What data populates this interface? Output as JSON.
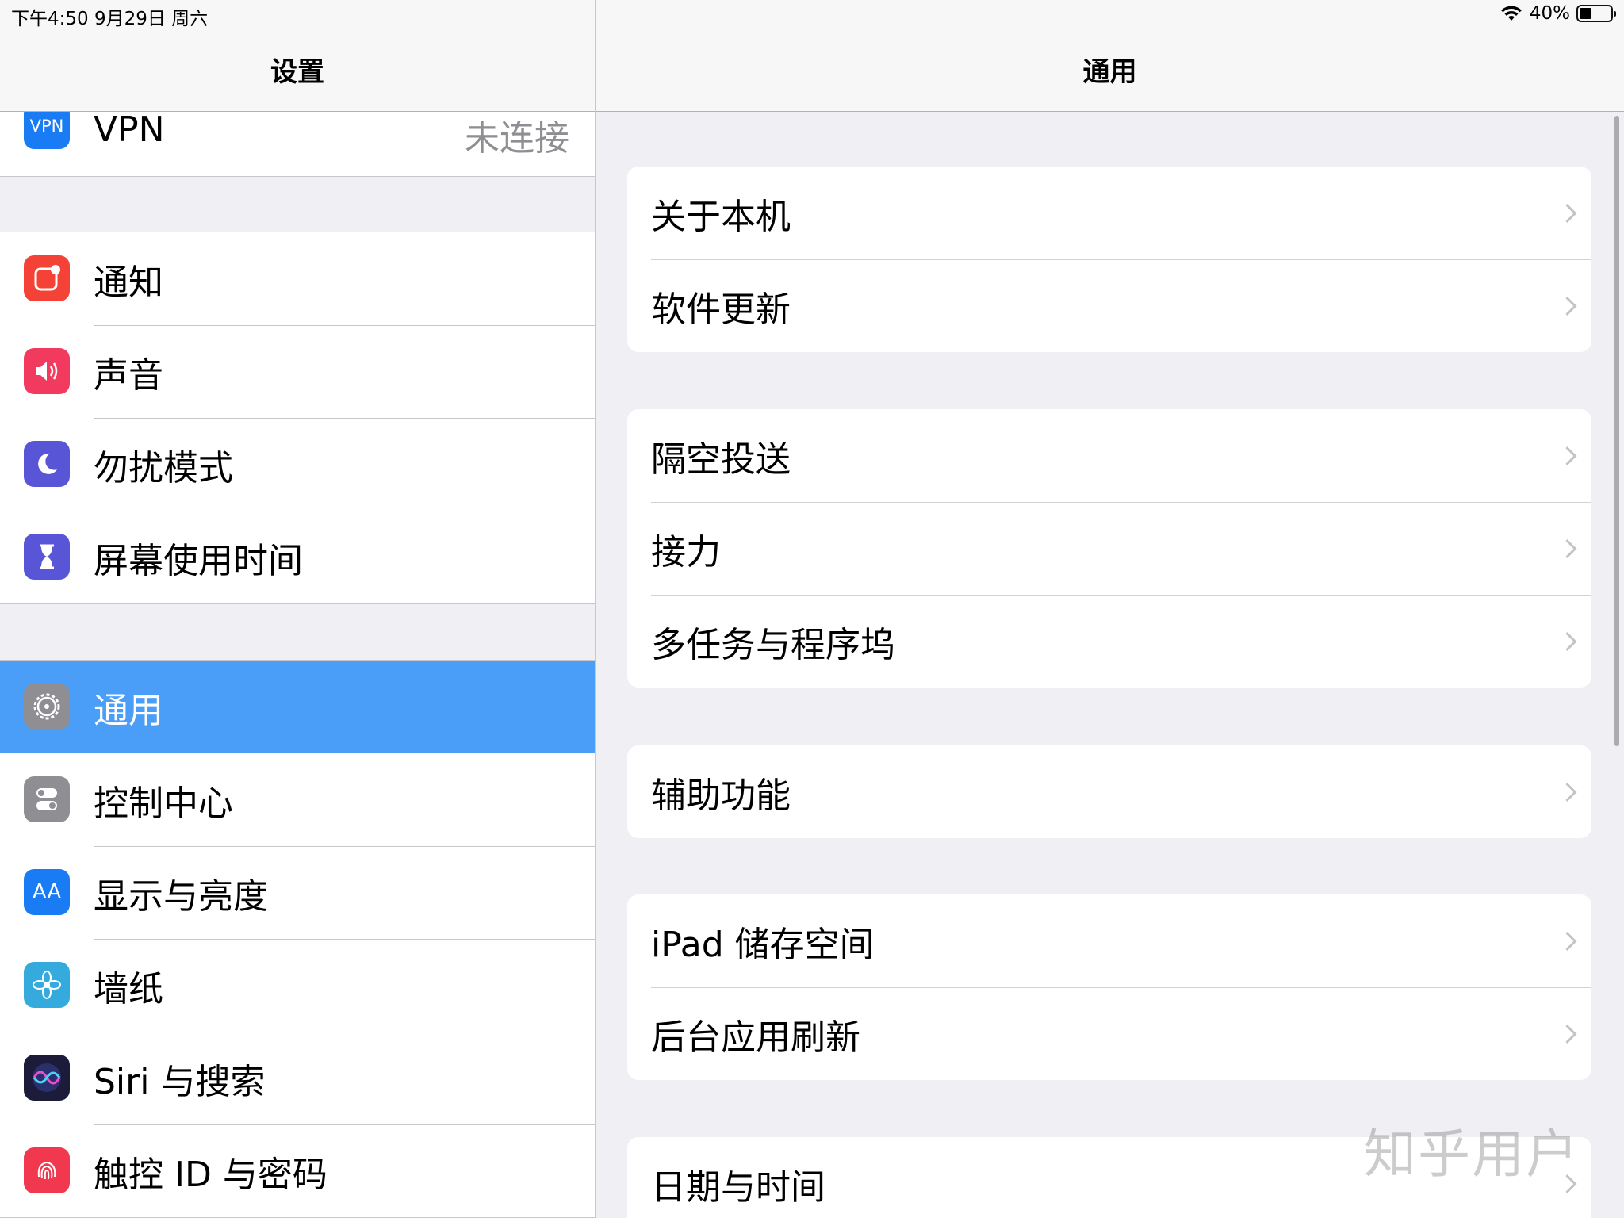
{
  "status_bar": {
    "time_date": "下午4:50  9月29日 周六",
    "battery": "40%",
    "battery_level": 0.4
  },
  "master": {
    "title": "设置",
    "vpn": {
      "icon_text": "VPN",
      "label": "VPN",
      "detail": "未连接"
    },
    "group1": [
      {
        "label": "通知",
        "icon": "notifications-icon",
        "color": "#f44336"
      },
      {
        "label": "声音",
        "icon": "sound-icon",
        "color": "#f23a5f"
      },
      {
        "label": "勿扰模式",
        "icon": "moon-icon",
        "color": "#5856d6"
      },
      {
        "label": "屏幕使用时间",
        "icon": "hourglass-icon",
        "color": "#5856d6"
      }
    ],
    "group2": [
      {
        "label": "通用",
        "icon": "gear-icon",
        "color": "#8e8e93",
        "selected": true
      },
      {
        "label": "控制中心",
        "icon": "toggles-icon",
        "color": "#8e8e93"
      },
      {
        "label": "显示与亮度",
        "icon": "text-size-icon",
        "color": "#1a7cf5",
        "icon_text": "AA"
      },
      {
        "label": "墙纸",
        "icon": "flower-icon",
        "color": "#35aadc"
      },
      {
        "label": "Siri 与搜索",
        "icon": "siri-icon",
        "color": "#1c1c3a"
      },
      {
        "label": "触控 ID 与密码",
        "icon": "fingerprint-icon",
        "color": "#f2384f"
      }
    ]
  },
  "detail": {
    "title": "通用",
    "groups": [
      [
        "关于本机",
        "软件更新"
      ],
      [
        "隔空投送",
        "接力",
        "多任务与程序坞"
      ],
      [
        "辅助功能"
      ],
      [
        "iPad 储存空间",
        "后台应用刷新"
      ],
      [
        "日期与时间"
      ]
    ],
    "watermark": "知乎用户"
  },
  "colors": {
    "selection": "#4b9ef8",
    "background": "#efeff4",
    "separator": "#c8c7cc"
  }
}
